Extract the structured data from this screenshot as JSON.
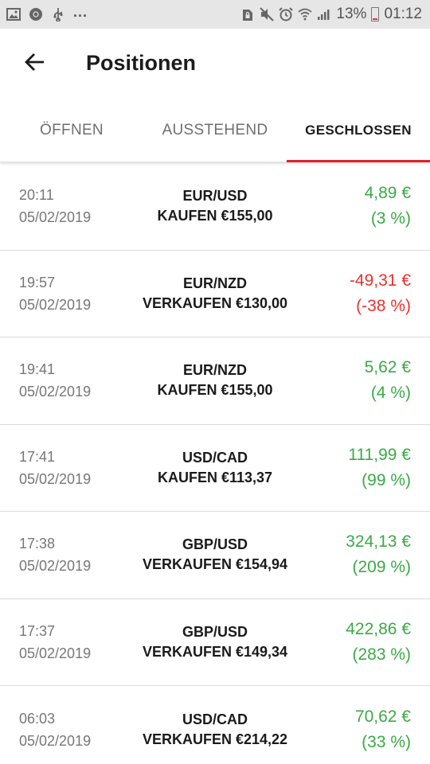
{
  "status_bar": {
    "left_icons": [
      "image-icon",
      "chrome-icon",
      "usb-icon"
    ],
    "more": "...",
    "right_icons": [
      "sim-lock-icon",
      "mute-icon",
      "alarm-icon",
      "wifi-icon",
      "signal-icon"
    ],
    "battery_percent": "13%",
    "battery_level": 0.13,
    "battery_color": "#e53935",
    "time": "01:12"
  },
  "header": {
    "back_icon": "arrow-left-icon",
    "title": "Positionen"
  },
  "tabs": [
    {
      "label": "ÖFFNEN",
      "active": false
    },
    {
      "label": "AUSSTEHEND",
      "active": false
    },
    {
      "label": "GESCHLOSSEN",
      "active": true
    }
  ],
  "colors": {
    "accent": "#e0202a",
    "profit": "#3aaa45",
    "loss": "#e8322e"
  },
  "positions": [
    {
      "time": "20:11",
      "date": "05/02/2019",
      "pair": "EUR/USD",
      "action": "KAUFEN",
      "amount": "€155,00",
      "pnl": "4,89 €",
      "pct": "(3 %)",
      "positive": true
    },
    {
      "time": "19:57",
      "date": "05/02/2019",
      "pair": "EUR/NZD",
      "action": "VERKAUFEN",
      "amount": "€130,00",
      "pnl": "-49,31 €",
      "pct": "(-38 %)",
      "positive": false
    },
    {
      "time": "19:41",
      "date": "05/02/2019",
      "pair": "EUR/NZD",
      "action": "KAUFEN",
      "amount": "€155,00",
      "pnl": "5,62 €",
      "pct": "(4 %)",
      "positive": true
    },
    {
      "time": "17:41",
      "date": "05/02/2019",
      "pair": "USD/CAD",
      "action": "KAUFEN",
      "amount": "€113,37",
      "pnl": "111,99 €",
      "pct": "(99 %)",
      "positive": true
    },
    {
      "time": "17:38",
      "date": "05/02/2019",
      "pair": "GBP/USD",
      "action": "VERKAUFEN",
      "amount": "€154,94",
      "pnl": "324,13 €",
      "pct": "(209 %)",
      "positive": true
    },
    {
      "time": "17:37",
      "date": "05/02/2019",
      "pair": "GBP/USD",
      "action": "VERKAUFEN",
      "amount": "€149,34",
      "pnl": "422,86 €",
      "pct": "(283 %)",
      "positive": true
    },
    {
      "time": "06:03",
      "date": "05/02/2019",
      "pair": "USD/CAD",
      "action": "VERKAUFEN",
      "amount": "€214,22",
      "pnl": "70,62 €",
      "pct": "(33 %)",
      "positive": true
    }
  ]
}
